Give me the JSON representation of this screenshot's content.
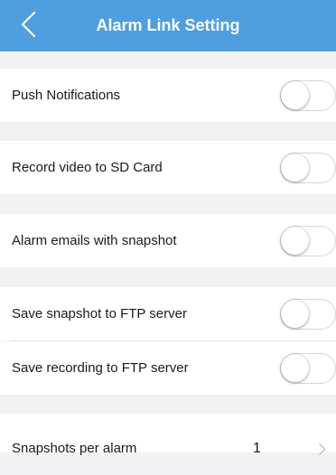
{
  "header": {
    "title": "Alarm Link Setting",
    "back_icon": "chevron-left-icon",
    "bg_color": "#4f9ee0"
  },
  "settings": [
    {
      "label": "Push Notifications",
      "enabled": false
    },
    {
      "label": "Record video to SD Card",
      "enabled": false
    },
    {
      "label": "Alarm emails with snapshot",
      "enabled": false
    },
    {
      "label": "Save snapshot to FTP server",
      "enabled": false
    },
    {
      "label": "Save recording to FTP server",
      "enabled": false
    }
  ],
  "snapshots": {
    "label": "Snapshots per alarm",
    "value": "1",
    "icon": "chevron-right-icon"
  }
}
